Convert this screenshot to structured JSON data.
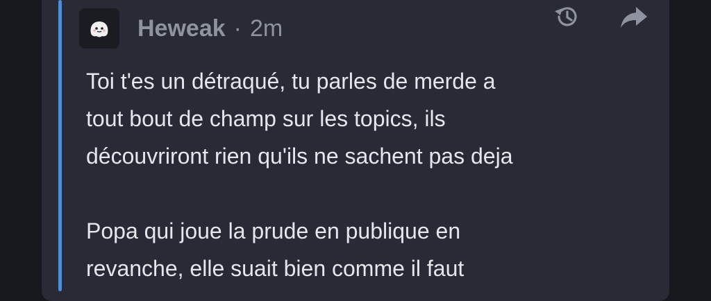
{
  "comment": {
    "author": "Heweak",
    "separator": "·",
    "time": "2m",
    "avatar_icon": "ghost-avatar-icon",
    "actions": {
      "history_icon": "history-icon",
      "share_icon": "share-arrow-icon"
    },
    "body": {
      "paragraph1": [
        "Toi t'es un détraqué, tu parles de merde a",
        "tout bout de champ sur les topics, ils",
        "découvriront rien qu'ils ne sachent pas deja"
      ],
      "paragraph2": [
        "Popa qui joue la prude en publique en",
        "revanche, elle suait bien comme il faut"
      ]
    }
  },
  "colors": {
    "background": "#17181d",
    "card": "#282a35",
    "quote_bar": "#4b8fe0",
    "meta_text": "#8f929f",
    "body_text": "#e6e7ec"
  }
}
